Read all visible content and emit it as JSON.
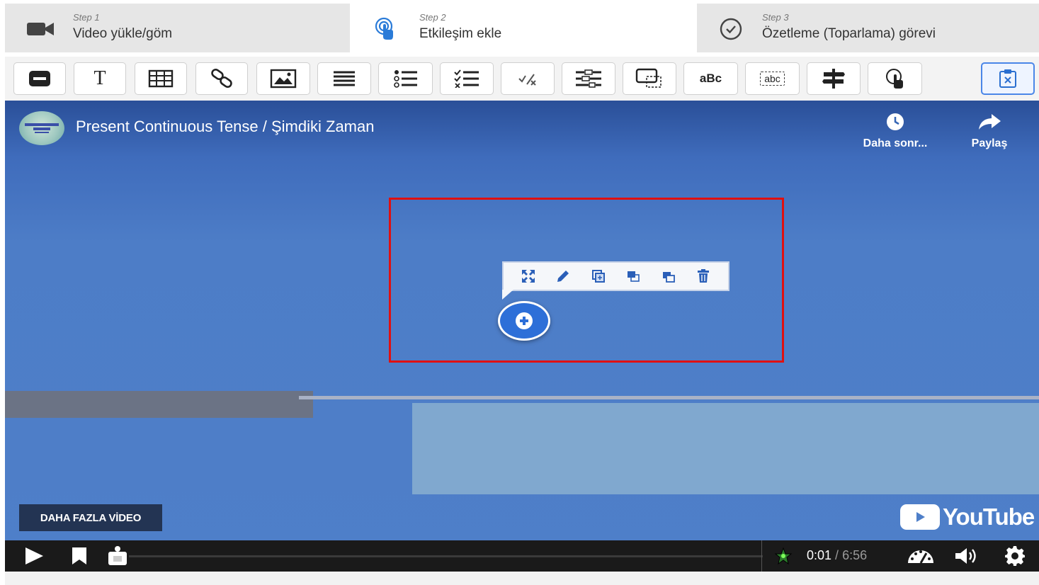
{
  "steps": [
    {
      "small": "Step 1",
      "title": "Video yükle/göm",
      "icon": "video-camera-icon"
    },
    {
      "small": "Step 2",
      "title": "Etkileşim ekle",
      "icon": "touch-pointer-icon"
    },
    {
      "small": "Step 3",
      "title": "Özetleme (Toparlama) görevi",
      "icon": "check-circle-icon"
    }
  ],
  "toolbar": {
    "text_glyph": "T",
    "abc_label": "aBc",
    "abc_box_label": "abc"
  },
  "video": {
    "title": "Present Continuous Tense / Şimdiki Zaman",
    "watch_later_label": "Daha sonr...",
    "share_label": "Paylaş",
    "more_videos_label": "DAHA FAZLA VİDEO",
    "youtube_label": "YouTube",
    "time_current": "0:01",
    "time_separator": " / ",
    "time_total": "6:56"
  },
  "colors": {
    "accent": "#4a86e8",
    "highlight": "#e01010",
    "add_button": "#2d6fd8"
  }
}
